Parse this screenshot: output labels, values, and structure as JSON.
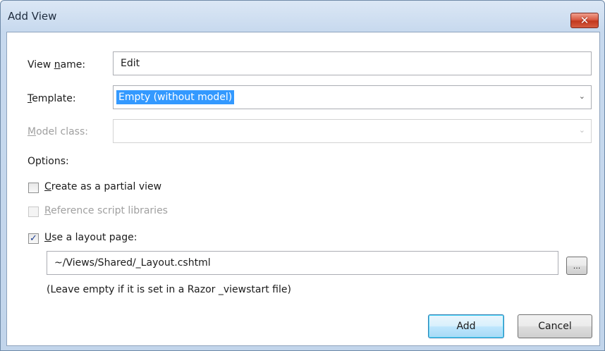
{
  "window": {
    "title": "Add View",
    "close_glyph": "✕"
  },
  "form": {
    "view_name": {
      "label_pre": "View ",
      "label_accel": "n",
      "label_post": "ame:",
      "value": "Edit"
    },
    "template": {
      "label_accel": "T",
      "label_post": "emplate:",
      "value": "Empty (without model)"
    },
    "model_class": {
      "label_accel": "M",
      "label_post": "odel class:",
      "value": ""
    },
    "options_label": "Options:",
    "partial_view": {
      "accel": "C",
      "text": "reate as a partial view",
      "checked": false
    },
    "script_libraries": {
      "accel": "R",
      "text": "eference script libraries",
      "checked": false,
      "disabled": true
    },
    "layout_page": {
      "accel": "U",
      "text": "se a layout page:",
      "checked": true,
      "path": "~/Views/Shared/_Layout.cshtml",
      "browse_label": "...",
      "hint": "(Leave empty if it is set in a Razor _viewstart file)"
    }
  },
  "buttons": {
    "add": "Add",
    "cancel": "Cancel"
  },
  "icons": {
    "dropdown_arrow": "⌄",
    "check_mark": "✓"
  }
}
